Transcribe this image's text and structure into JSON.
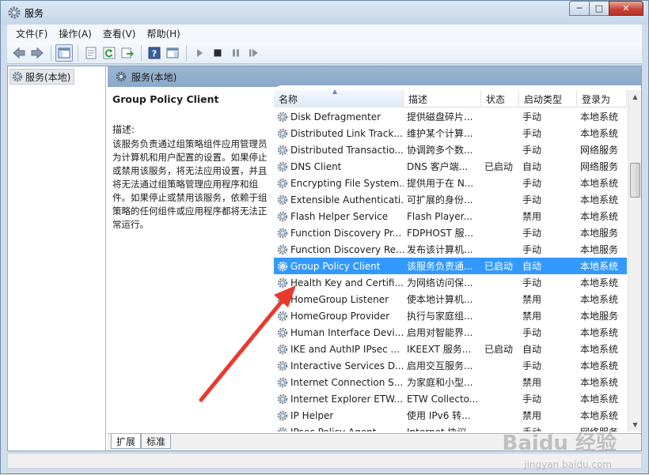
{
  "window": {
    "title": "服务",
    "controls": {
      "minimize": "─",
      "maximize": "□",
      "close": "✕"
    }
  },
  "menu": [
    "文件(F)",
    "操作(A)",
    "查看(V)",
    "帮助(H)"
  ],
  "toolbar": {
    "icons": [
      "back-icon",
      "forward-icon",
      "show-hide-tree-icon",
      "properties-icon",
      "refresh-icon",
      "export-list-icon",
      "help-icon",
      "show-hide-action-pane-icon",
      "start-service-icon",
      "stop-service-icon",
      "pause-service-icon",
      "restart-service-icon"
    ]
  },
  "tree": {
    "item": "服务(本地)"
  },
  "main": {
    "header": "服务(本地)",
    "description": {
      "service_name": "Group Policy Client",
      "label": "描述:",
      "text": "该服务负责通过组策略组件应用管理员为计算机和用户配置的设置。如果停止或禁用该服务，将无法应用设置，并且将无法通过组策略管理应用程序和组件。如果停止或禁用该服务，依赖于组策略的任何组件或应用程序都将无法正常运行。"
    },
    "columns": [
      "名称",
      "描述",
      "状态",
      "启动类型",
      "登录为"
    ],
    "rows": [
      {
        "name": "Disk Defragmenter",
        "desc": "提供磁盘碎片...",
        "status": "",
        "start": "手动",
        "logon": "本地系统"
      },
      {
        "name": "Distributed Link Track...",
        "desc": "维护某个计算...",
        "status": "",
        "start": "手动",
        "logon": "本地系统"
      },
      {
        "name": "Distributed Transactio...",
        "desc": "协调跨多个数...",
        "status": "",
        "start": "手动",
        "logon": "网络服务"
      },
      {
        "name": "DNS Client",
        "desc": "DNS 客户端...",
        "status": "已启动",
        "start": "自动",
        "logon": "网络服务"
      },
      {
        "name": "Encrypting File System...",
        "desc": "提供用于在 N...",
        "status": "",
        "start": "手动",
        "logon": "本地系统"
      },
      {
        "name": "Extensible Authenticati...",
        "desc": "可扩展的身份...",
        "status": "",
        "start": "手动",
        "logon": "本地系统"
      },
      {
        "name": "Flash Helper Service",
        "desc": "Flash Player...",
        "status": "",
        "start": "禁用",
        "logon": "本地系统"
      },
      {
        "name": "Function Discovery Pr...",
        "desc": "FDPHOST 服...",
        "status": "",
        "start": "手动",
        "logon": "本地服务"
      },
      {
        "name": "Function Discovery Re...",
        "desc": "发布该计算机...",
        "status": "",
        "start": "手动",
        "logon": "本地服务"
      },
      {
        "name": "Group Policy Client",
        "desc": "该服务负责通...",
        "status": "已启动",
        "start": "自动",
        "logon": "本地系统",
        "selected": true
      },
      {
        "name": "Health Key and Certifi...",
        "desc": "为网络访问保...",
        "status": "",
        "start": "手动",
        "logon": "本地系统"
      },
      {
        "name": "HomeGroup Listener",
        "desc": "使本地计算机...",
        "status": "",
        "start": "禁用",
        "logon": "本地系统"
      },
      {
        "name": "HomeGroup Provider",
        "desc": "执行与家庭组...",
        "status": "",
        "start": "禁用",
        "logon": "本地服务"
      },
      {
        "name": "Human Interface Devi...",
        "desc": "启用对智能界...",
        "status": "",
        "start": "手动",
        "logon": "本地系统"
      },
      {
        "name": "IKE and AuthIP IPsec ...",
        "desc": "IKEEXT 服务...",
        "status": "已启动",
        "start": "自动",
        "logon": "本地系统"
      },
      {
        "name": "Interactive Services D...",
        "desc": "启用交互服务...",
        "status": "",
        "start": "手动",
        "logon": "本地系统"
      },
      {
        "name": "Internet Connection S...",
        "desc": "为家庭和小型...",
        "status": "",
        "start": "禁用",
        "logon": "本地系统"
      },
      {
        "name": "Internet Explorer ETW...",
        "desc": "ETW Collecto...",
        "status": "",
        "start": "手动",
        "logon": "本地系统"
      },
      {
        "name": "IP Helper",
        "desc": "使用 IPv6 转...",
        "status": "",
        "start": "禁用",
        "logon": "本地系统"
      },
      {
        "name": "IPsec Policy Agent",
        "desc": "Internet 协议...",
        "status": "",
        "start": "手动",
        "logon": "网络服务"
      }
    ],
    "tabs": [
      "扩展",
      "标准"
    ]
  },
  "watermark": {
    "brand": "Baidu 经验",
    "url": "jingyan.baidu.com"
  },
  "colors": {
    "selected_row": "#3399ff",
    "annotation_arrow": "#e83a2e"
  }
}
